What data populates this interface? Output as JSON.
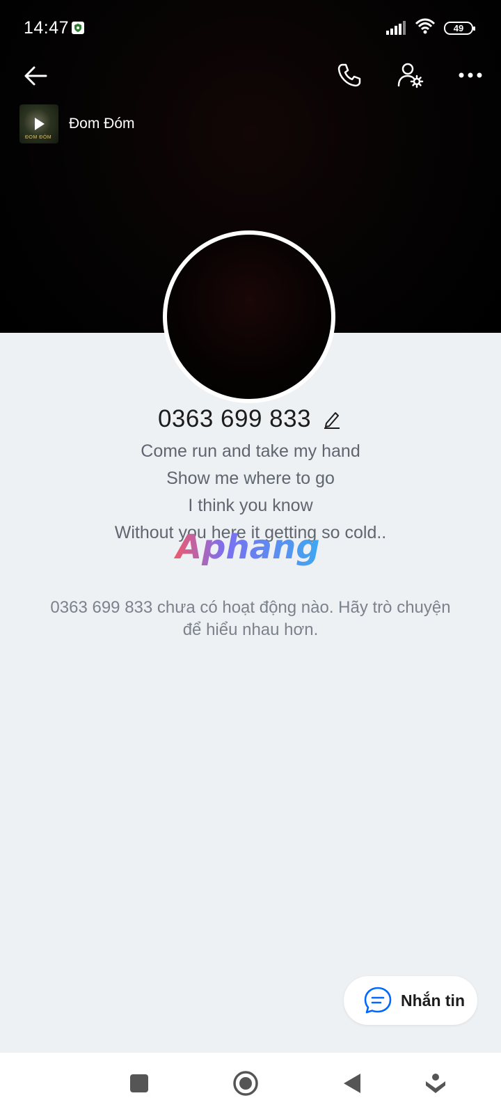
{
  "status_bar": {
    "time": "14:47",
    "battery": "49",
    "icons": [
      "shield-icon",
      "signal-icon",
      "wifi-icon",
      "battery-icon"
    ]
  },
  "header": {
    "icons": [
      "back-arrow-icon",
      "phone-icon",
      "user-settings-icon",
      "more-icon"
    ]
  },
  "music": {
    "title": "Đom Đóm",
    "thumb_text": "ĐOM ĐÓM"
  },
  "profile": {
    "name": "0363 699 833",
    "bio": [
      "Come run and take my hand",
      "Show me where to go",
      "I think you know",
      "Without you here it getting so cold.."
    ],
    "empty_note": "0363 699 833 chưa có hoạt động nào. Hãy trò chuyện để hiểu nhau hơn."
  },
  "watermark": "Aphang",
  "message_button": {
    "label": "Nhắn tin"
  },
  "colors": {
    "background": "#eef1f4",
    "accent": "#0068ff",
    "text_primary": "#1c1c1c",
    "text_secondary": "#5f6670"
  }
}
